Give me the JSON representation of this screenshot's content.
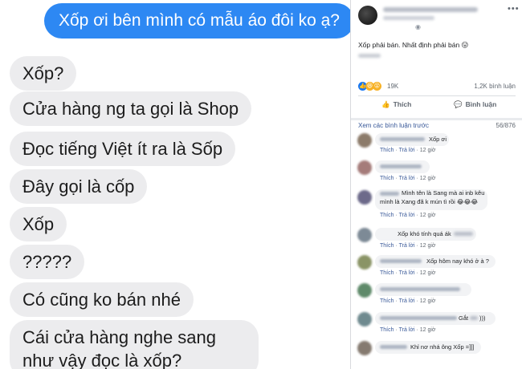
{
  "chat": {
    "outgoing": "Xốp ơi bên mình có mẫu áo đôi ko ạ?",
    "incoming": [
      "Xốp?",
      "Cửa hàng ng ta gọi là Shop",
      "Đọc tiếng Việt ít ra là Sốp",
      "Đây gọi là cốp",
      "Xốp",
      "?????",
      "Có cũng ko bán nhé",
      "Cái cửa hàng nghe sang như vậy đọc là xốp?"
    ]
  },
  "post": {
    "body": "Xốp phải bán. Nhất định phải bán 😛",
    "reaction_count": "19K",
    "comment_count": "1,2K bình luận",
    "actions": {
      "like": "Thích",
      "comment": "Bình luận"
    },
    "view_more": "Xem các bình luận trước",
    "comment_position": "56/876",
    "comments": [
      {
        "text": "Xốp ơi",
        "like": "Thích",
        "reply": "Trả lời",
        "time": "12 giờ"
      },
      {
        "text": "",
        "like": "Thích",
        "reply": "Trả lời",
        "time": "12 giờ"
      },
      {
        "text_line1": "Mình tên là Sang mà ai inb kêu",
        "text_line2": "mình là Xang đã k mún tì rồi 😂😂😂",
        "like": "Thích",
        "reply": "Trả lời",
        "time": "12 giờ"
      },
      {
        "text": "Xốp khó tính quá ák",
        "like": "Thích",
        "reply": "Trả lời",
        "time": "12 giờ"
      },
      {
        "text": "Xốp hôm nay khó ở à ?",
        "like": "Thích",
        "reply": "Trả lời",
        "time": "12 giờ"
      },
      {
        "text": "",
        "like": "Thích",
        "reply": "Trả lời",
        "time": "12 giờ"
      },
      {
        "text": "Gắt",
        "text_tail": ")))",
        "like": "Thích",
        "reply": "Trả lời",
        "time": "12 giờ"
      },
      {
        "text": "Khỉ nơ nhá ông Xốp =]]]"
      }
    ]
  }
}
